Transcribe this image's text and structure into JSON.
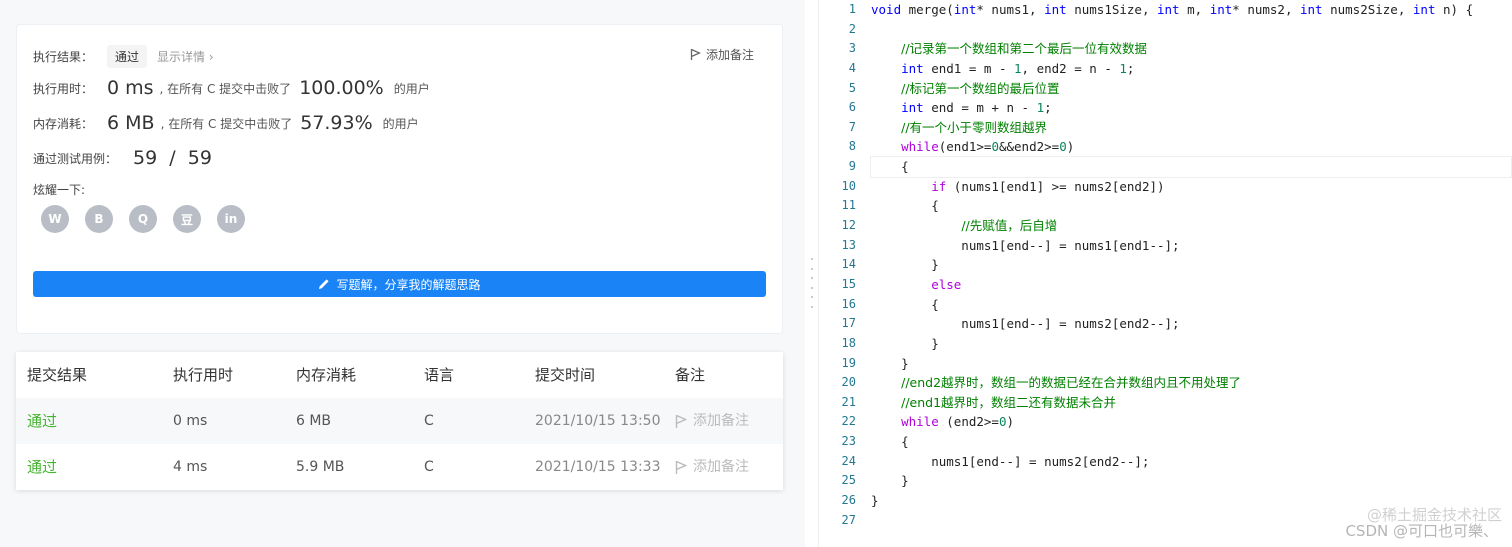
{
  "result": {
    "exec_result_label": "执行结果：",
    "status": "通过",
    "detail_link": "显示详情",
    "add_note": "添加备注",
    "runtime_label": "执行用时：",
    "runtime_value": "0 ms",
    "runtime_mid": ", 在所有 C 提交中击败了",
    "runtime_pct": "100.00%",
    "runtime_suffix": "的用户",
    "memory_label": "内存消耗：",
    "memory_value": "6 MB",
    "memory_mid": ", 在所有 C 提交中击败了",
    "memory_pct": "57.93%",
    "memory_suffix": "的用户",
    "tests_label": "通过测试用例：",
    "tests_value": "59  /  59",
    "share_label": "炫耀一下:",
    "share_icons": [
      "wechat-icon",
      "weibo-icon",
      "qq-icon",
      "douban-icon",
      "linkedin-icon"
    ],
    "share_glyphs": [
      "W",
      "B",
      "Q",
      "豆",
      "in"
    ],
    "write_solution": "写题解，分享我的解题思路"
  },
  "submissions": {
    "headers": [
      "提交结果",
      "执行用时",
      "内存消耗",
      "语言",
      "提交时间",
      "备注"
    ],
    "rows": [
      {
        "status": "通过",
        "runtime": "0 ms",
        "memory": "6 MB",
        "language": "C",
        "time": "2021/10/15 13:50",
        "note": "添加备注"
      },
      {
        "status": "通过",
        "runtime": "4 ms",
        "memory": "5.9 MB",
        "language": "C",
        "time": "2021/10/15 13:33",
        "note": "添加备注"
      }
    ]
  },
  "editor": {
    "line_numbers": [
      "1",
      "2",
      "3",
      "4",
      "5",
      "6",
      "7",
      "8",
      "9",
      "10",
      "11",
      "12",
      "13",
      "14",
      "15",
      "16",
      "17",
      "18",
      "19",
      "20",
      "21",
      "22",
      "23",
      "24",
      "25",
      "26",
      "27"
    ],
    "lines": [
      "void merge(int* nums1, int nums1Size, int m, int* nums2, int nums2Size, int n) {",
      "",
      "    //记录第一个数组和第二个最后一位有效数据",
      "    int end1 = m - 1, end2 = n - 1;",
      "    //标记第一个数组的最后位置",
      "    int end = m + n - 1;",
      "    //有一个小于零则数组越界",
      "    while(end1>=0&&end2>=0)",
      "    {",
      "        if (nums1[end1] >= nums2[end2])",
      "        {",
      "            //先赋值，后自增",
      "            nums1[end--] = nums1[end1--];",
      "        }",
      "        else",
      "        {",
      "            nums1[end--] = nums2[end2--];",
      "        }",
      "    }",
      "    //end2越界时，数组一的数据已经在合并数组内且不用处理了",
      "    //end1越界时，数组二还有数据未合并",
      "    while (end2>=0)",
      "    {",
      "        nums1[end--] = nums2[end2--];",
      "    }",
      "}",
      ""
    ]
  },
  "watermark": {
    "line1": "@稀土掘金技术社区",
    "line2": "CSDN @可口也可樂、"
  }
}
